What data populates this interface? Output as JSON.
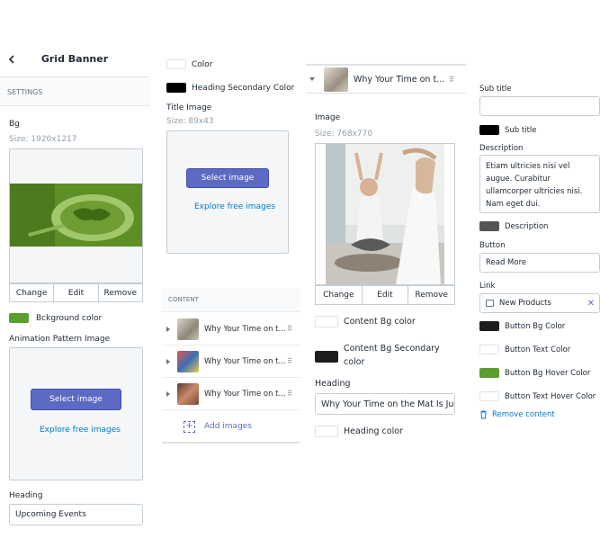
{
  "panel1": {
    "title": "Grid Banner",
    "settings_label": "SETTINGS",
    "bg_label": "Bg",
    "bg_size": "Size: 1920x1217",
    "actions": [
      "Change",
      "Edit",
      "Remove"
    ],
    "bg_color_label": "Bckground color",
    "bg_color": "#5a9e2f",
    "anim_label": "Animation Pattern Image",
    "select_image": "Select image",
    "explore_free": "Explore free images",
    "heading_label": "Heading",
    "heading_value": "Upcoming Events"
  },
  "panel2": {
    "color_label": "Color",
    "color_value": "#ffffff",
    "heading_secondary_label": "Heading Secondary Color",
    "heading_secondary_color": "#000000",
    "title_image_label": "Title Image",
    "title_image_size": "Size: 89x43",
    "select_image": "Select image",
    "explore_free": "Explore free images",
    "content_label": "CONTENT",
    "items": [
      {
        "label": "Why Your Time on t..."
      },
      {
        "label": "Why Your Time on t..."
      },
      {
        "label": "Why Your Time on t..."
      }
    ],
    "add_images": "Add images"
  },
  "panel3": {
    "block_title": "Why Your Time on t...",
    "image_label": "Image",
    "image_size": "Size: 768x770",
    "actions": [
      "Change",
      "Edit",
      "Remove"
    ],
    "content_bg_label": "Content Bg color",
    "content_bg_color": "#ffffff",
    "content_bg_secondary_label_1": "Content Bg Secondary",
    "content_bg_secondary_label_2": "color",
    "content_bg_secondary_color": "#1c1c1c",
    "heading_label": "Heading",
    "heading_value": "Why Your Time on the Mat Is Jus",
    "heading_color_label": "Heading color",
    "heading_color": "#ffffff"
  },
  "panel4": {
    "subtitle_label": "Sub title",
    "subtitle_value": "",
    "subtitle_color_label": "Sub title",
    "subtitle_color": "#000000",
    "description_label": "Description",
    "description_value": "Etiam ultricies nisi vel augue. Curabitur ullamcorper ultricies nisi. Nam eget dui.",
    "description_color_label": "Description",
    "description_color": "#555555",
    "button_label": "Button",
    "button_value": "Read More",
    "link_label": "Link",
    "link_value": "New Products",
    "button_bg_label": "Button Bg Color",
    "button_bg_color": "#1c1c1c",
    "button_text_label": "Button Text Color",
    "button_text_color": "#ffffff",
    "button_hover_label": "Button Bg Hover Color",
    "button_hover_color": "#5a9e2f",
    "button_text_hover_label": "Button Text Hover Color",
    "button_text_hover_color": "#ffffff",
    "remove_content": "Remove content"
  }
}
